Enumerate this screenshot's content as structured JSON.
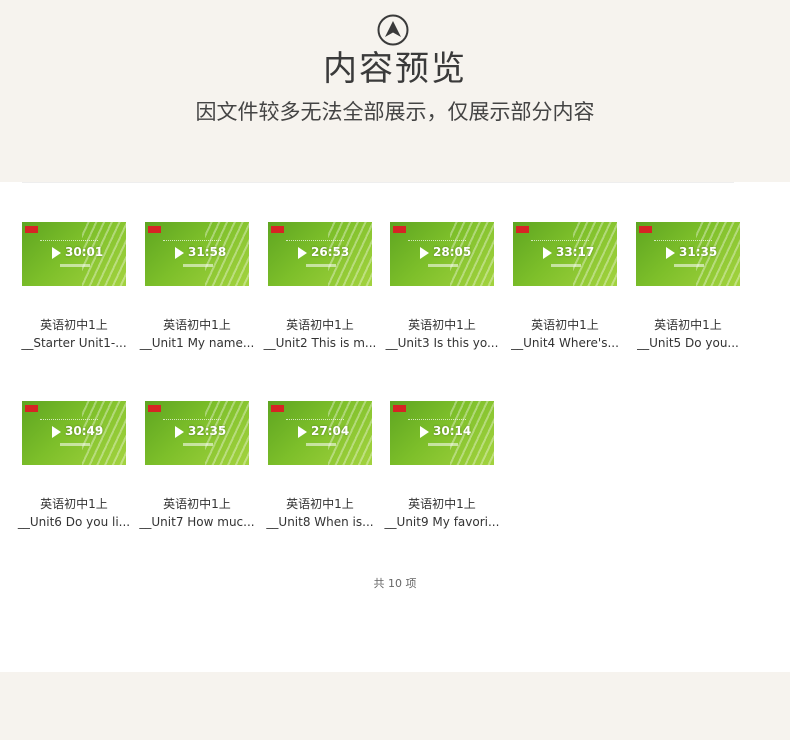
{
  "header": {
    "title": "内容预览",
    "subtitle": "因文件较多无法全部展示，仅展示部分内容"
  },
  "items": [
    {
      "title": "英语初中1上",
      "name": "__Starter Unit1-...",
      "duration": "30:01"
    },
    {
      "title": "英语初中1上",
      "name": "__Unit1 My name...",
      "duration": "31:58"
    },
    {
      "title": "英语初中1上",
      "name": "__Unit2 This is m...",
      "duration": "26:53"
    },
    {
      "title": "英语初中1上",
      "name": "__Unit3 Is this yo...",
      "duration": "28:05"
    },
    {
      "title": "英语初中1上",
      "name": "__Unit4 Where's...",
      "duration": "33:17"
    },
    {
      "title": "英语初中1上",
      "name": "__Unit5 Do you...",
      "duration": "31:35"
    },
    {
      "title": "英语初中1上",
      "name": "__Unit6 Do you li...",
      "duration": "30:49"
    },
    {
      "title": "英语初中1上",
      "name": "__Unit7 How muc...",
      "duration": "32:35"
    },
    {
      "title": "英语初中1上",
      "name": "__Unit8 When is...",
      "duration": "27:04"
    },
    {
      "title": "英语初中1上",
      "name": "__Unit9 My favori...",
      "duration": "30:14"
    }
  ],
  "total_label": "共 10 项",
  "colors": {
    "page_bg": "#f6f3ee",
    "thumb_green": "#7dbf2a",
    "badge_red": "#d62424"
  }
}
